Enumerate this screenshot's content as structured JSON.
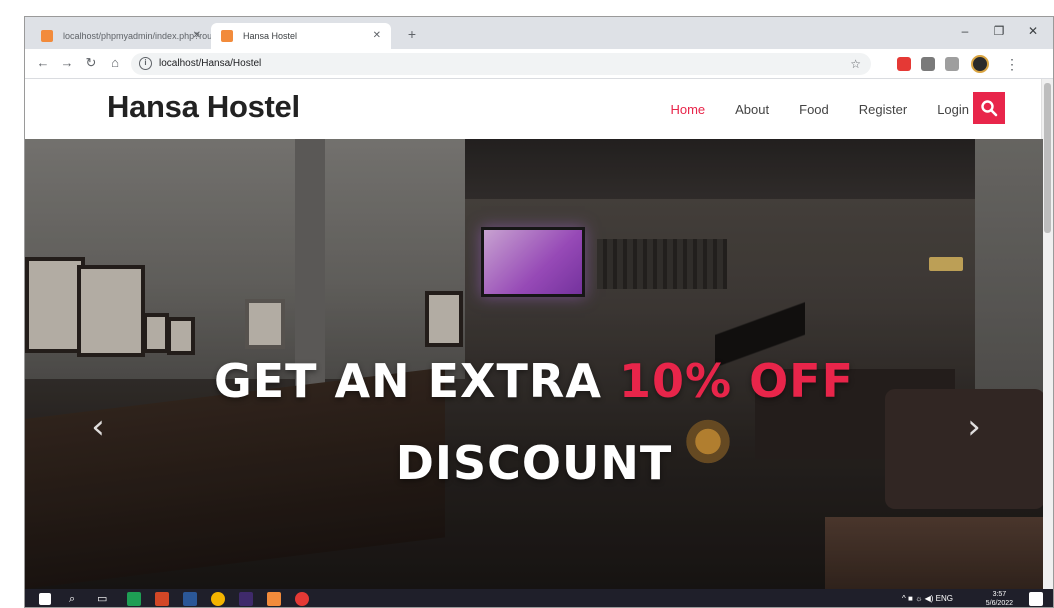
{
  "browser": {
    "tabs": [
      {
        "title": "localhost/phpmyadmin/index.php?route=..."
      },
      {
        "title": "Hansa Hostel"
      }
    ],
    "new_tab_icon": "plus-icon",
    "url": "localhost/Hansa/Hostel"
  },
  "site": {
    "brand": "Hansa Hostel",
    "nav": [
      {
        "label": "Home",
        "active": true
      },
      {
        "label": "About",
        "active": false
      },
      {
        "label": "Food",
        "active": false
      },
      {
        "label": "Register",
        "active": false
      },
      {
        "label": "Login",
        "active": false
      }
    ],
    "accent_color": "#e8254a",
    "search_icon": "search-icon"
  },
  "hero": {
    "line1_prefix": "GET AN EXTRA ",
    "line1_accent": "10% OFF",
    "line2": "DISCOUNT",
    "prev_symbol": "‹",
    "next_symbol": "›"
  },
  "taskbar": {
    "tray_text": "^ ■ ☼ ◀) ENG",
    "clock_time": "3:57",
    "clock_date": "5/6/2022"
  }
}
